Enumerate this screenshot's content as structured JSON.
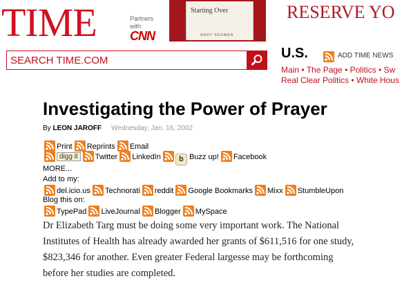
{
  "header": {
    "logo": "TIME",
    "partners": [
      "Partners",
      "with"
    ],
    "cnn": "CNN",
    "ad": {
      "book_title": "Starting Over",
      "book_author": "ANDY SEGWEN",
      "text": "RESERVE YO"
    }
  },
  "search": {
    "placeholder": "SEARCH TIME.COM"
  },
  "us_nav": {
    "title": "U.S.",
    "add_news": "ADD TIME NEWS",
    "row1": [
      "Main",
      "The Page",
      "Politics",
      "Sw"
    ],
    "row2": [
      "Real Clear Politics",
      "White Hous"
    ]
  },
  "article": {
    "headline": "Investigating the Power of Prayer",
    "by": "By",
    "author": "LEON JAROFF",
    "date": "Wednesday, Jan. 16, 2002",
    "tools_row1": [
      "Print",
      "Reprints",
      "Email"
    ],
    "digg": "digg it",
    "tools_row2": [
      "Twitter",
      "LinkedIn",
      "Buzz up!",
      "Facebook"
    ],
    "buzz_glyph": "b",
    "more": "MORE...",
    "add_to_my": "Add to my:",
    "bookmarks": [
      "del.icio.us",
      "Technorati",
      "reddit",
      "Google Bookmarks",
      "Mixx",
      "StumbleUpon"
    ],
    "blog_this_on": "Blog this on:",
    "blogs": [
      "TypePad",
      "LiveJournal",
      "Blogger",
      "MySpace"
    ],
    "body_lines": [
      "Dr Elizabeth Targ must be doing some very important work. The National",
      "Institutes of Health has already awarded her grants of $611,516 for one study,",
      "$823,346 for another. Even greater Federal largesse may be forthcoming",
      "before her studies are completed."
    ]
  },
  "colors": {
    "brand_red": "#d0101f",
    "link_red": "#c0101a",
    "rss_orange": "#f07f1c"
  },
  "icons": {
    "rss": "rss-icon",
    "search": "magnifier-icon"
  }
}
